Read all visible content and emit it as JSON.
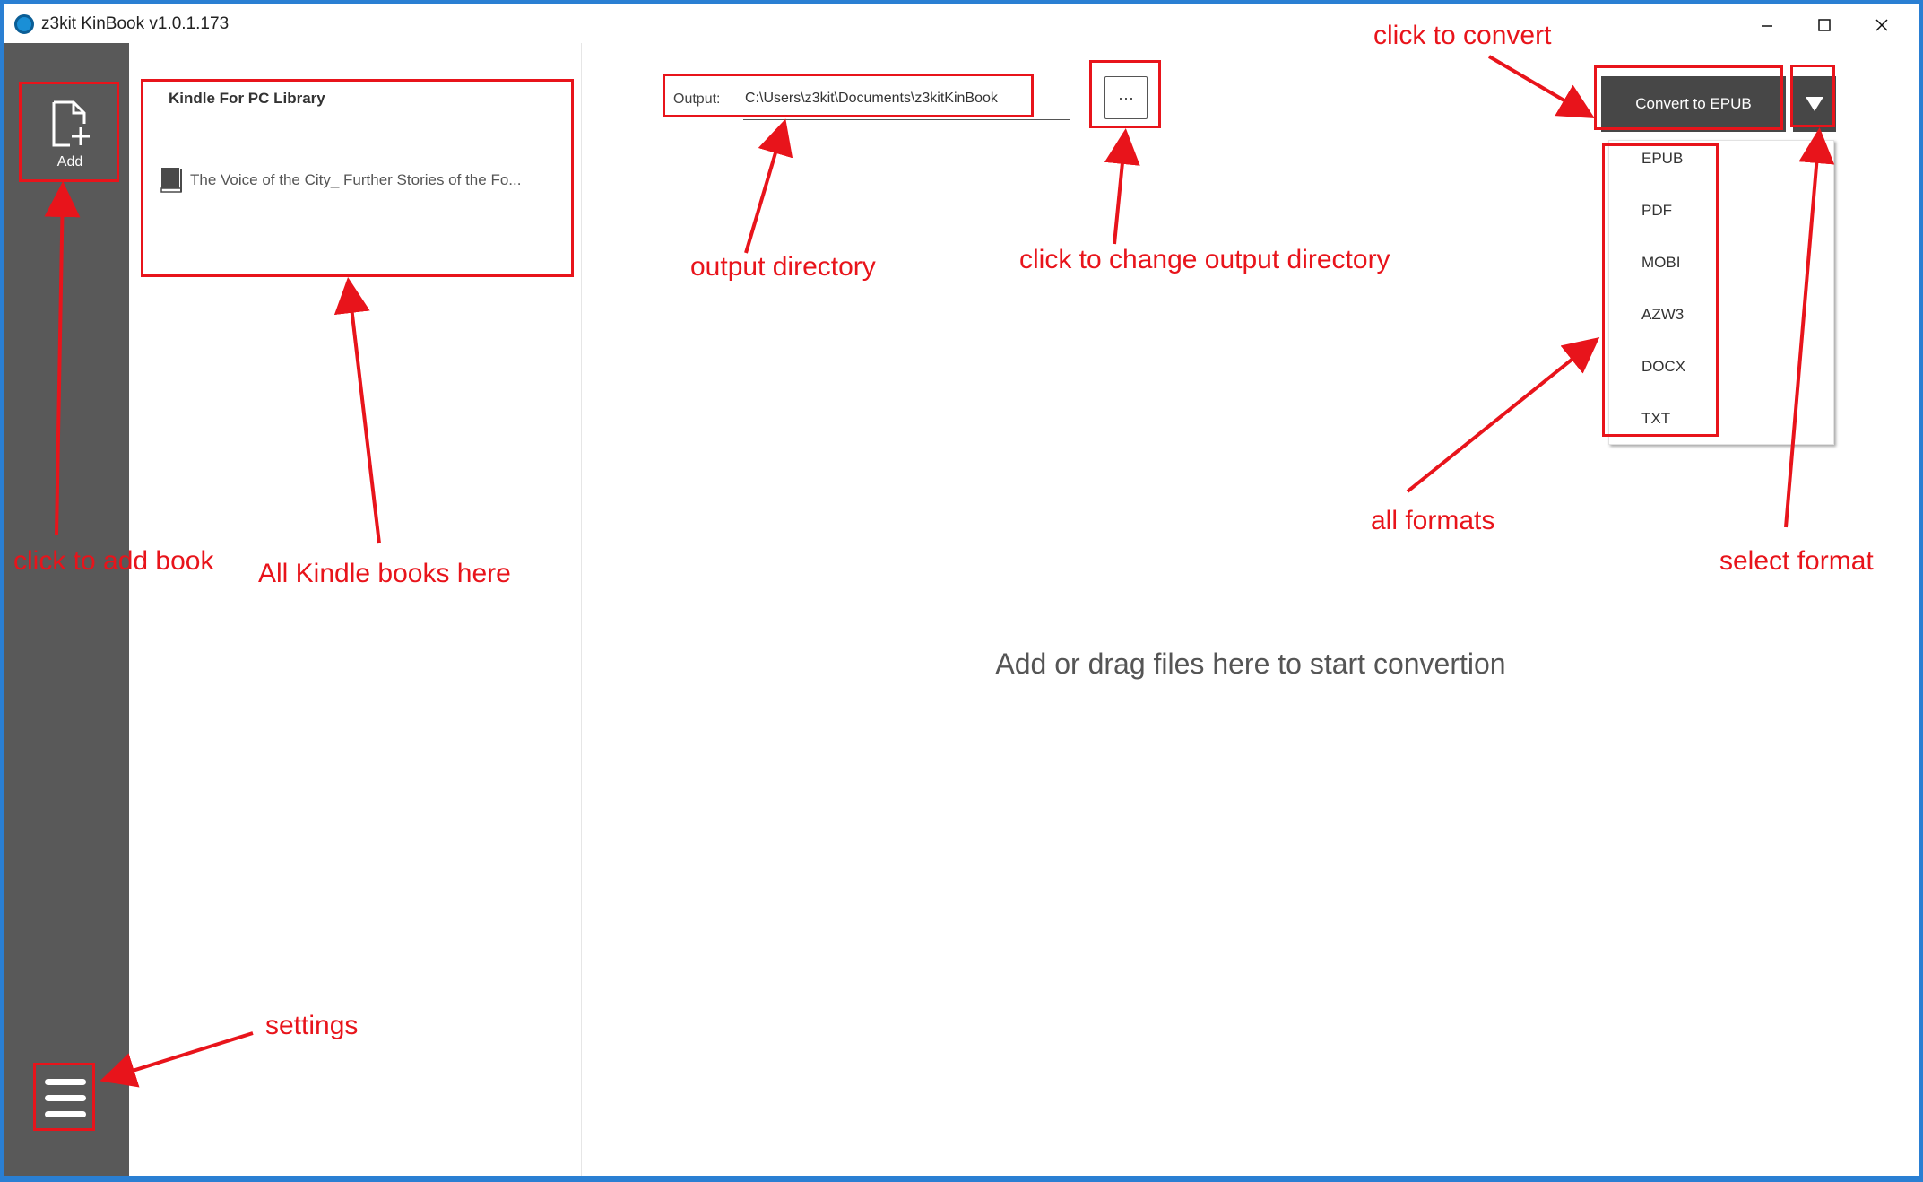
{
  "window": {
    "title": "z3kit KinBook v1.0.1.173",
    "controls": {
      "minimize": "—",
      "maximize": "☐",
      "close": "✕"
    }
  },
  "sidebar": {
    "add_label": "Add",
    "add_icon": "add-file-icon",
    "settings_icon": "hamburger-menu-icon"
  },
  "library": {
    "title": "Kindle For PC Library",
    "books": [
      {
        "title": "The Voice of the City_ Further Stories of the Fo...",
        "icon": "book-icon"
      }
    ]
  },
  "output": {
    "label": "Output:",
    "path": "C:\\Users\\z3kit\\Documents\\z3kitKinBook",
    "browse_label": "···"
  },
  "convert": {
    "button_label": "Convert to EPUB",
    "formats": [
      "EPUB",
      "PDF",
      "MOBI",
      "AZW3",
      "DOCX",
      "TXT"
    ]
  },
  "main": {
    "drop_hint": "Add or drag files here to start convertion"
  },
  "annotations": {
    "color": "#e8141b",
    "add_book": "click to add book",
    "all_books": "All Kindle books here",
    "output_dir": "output directory",
    "change_dir": "click to change output directory",
    "convert": "click to convert",
    "all_formats": "all formats",
    "select_format": "select format",
    "settings": "settings"
  }
}
